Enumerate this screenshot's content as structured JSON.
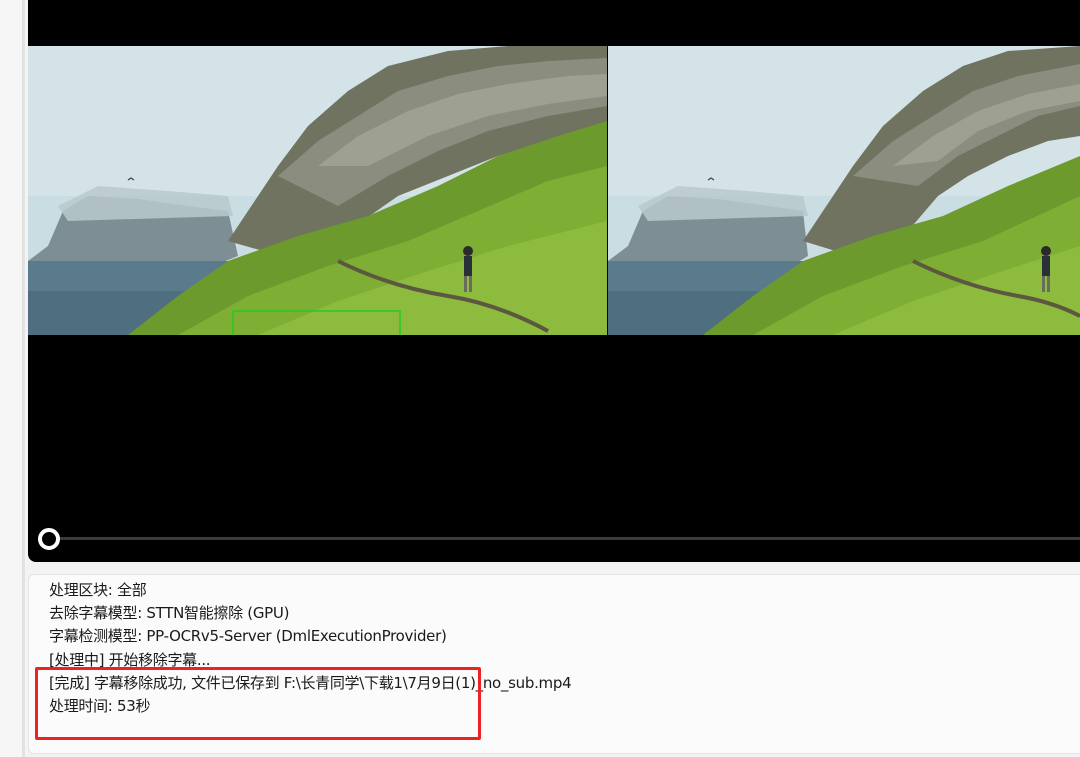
{
  "player": {
    "seek_position": 0.0
  },
  "log": {
    "lines": [
      "处理区块: 全部",
      "去除字幕模型: STTN智能擦除 (GPU)",
      "字幕检测模型: PP-OCRv5-Server (DmlExecutionProvider)",
      "[处理中] 开始移除字幕...",
      "[完成] 字幕移除成功, 文件已保存到 F:\\长青同学\\下载1\\7月9日(1)_no_sub.mp4",
      "处理时间: 53秒"
    ]
  },
  "colors": {
    "highlight": "#ee2222",
    "detection_box": "#22cc22",
    "player_bg": "#000000"
  },
  "icons": {
    "seek_knob": "circle-knob-icon"
  }
}
